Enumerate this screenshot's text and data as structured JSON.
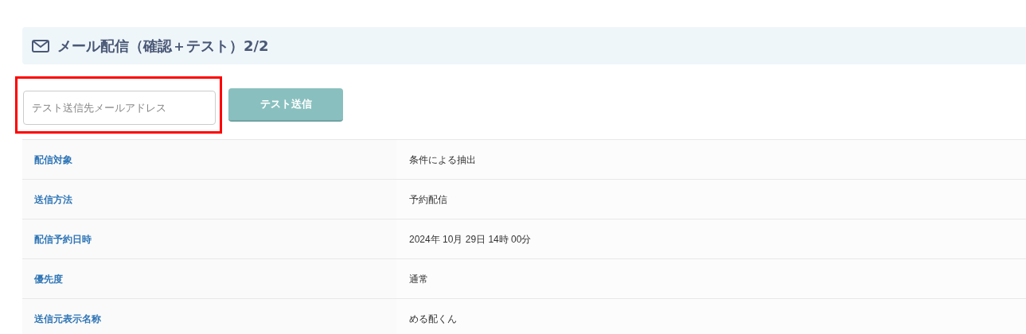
{
  "header": {
    "title": "メール配信（確認＋テスト）2/2"
  },
  "test_send": {
    "field": {
      "placeholder": "テスト送信先メールアドレス",
      "highlighted": true
    },
    "button": {
      "label": "テスト送信",
      "disabled": true
    }
  },
  "details": [
    {
      "label": "配信対象",
      "value": "条件による抽出"
    },
    {
      "label": "送信方法",
      "value": "予約配信"
    },
    {
      "label": "配信予約日時",
      "value": "2024年 10月 29日 14時 00分"
    },
    {
      "label": "優先度",
      "value": "通常"
    },
    {
      "label": "送信元表示名称",
      "value": "める配くん"
    }
  ]
}
